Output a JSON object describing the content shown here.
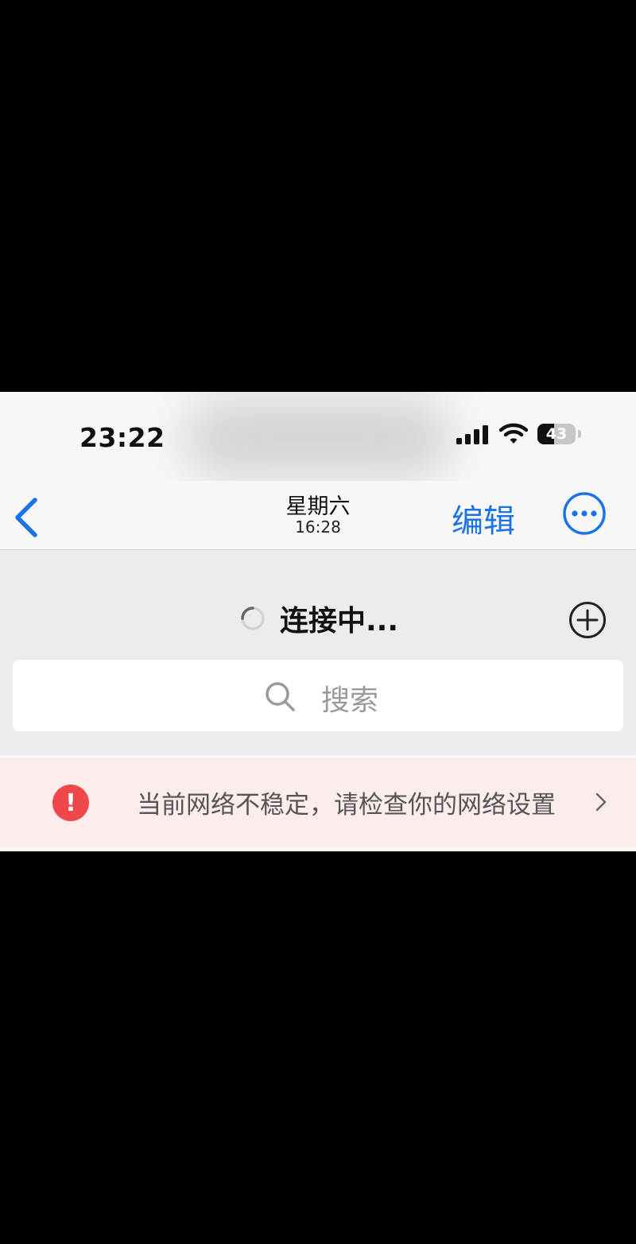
{
  "status_bar": {
    "time": "23:22",
    "battery_level": "43",
    "battery_fraction": 0.43,
    "icons": [
      "cellular-signal-icon",
      "wifi-icon",
      "battery-icon"
    ]
  },
  "nav": {
    "back_icon": "chevron-left-icon",
    "title": "星期六",
    "subtitle": "16:28",
    "edit_label": "编辑",
    "more_icon": "ellipsis-circle-icon"
  },
  "header": {
    "connecting_text": "连接中...",
    "spinner_icon": "loading-spinner-icon",
    "add_icon": "plus-circle-icon"
  },
  "search": {
    "placeholder": "搜索",
    "icon": "search-icon"
  },
  "warning": {
    "icon": "exclamation-circle-icon",
    "text": "当前网络不稳定，请检查你的网络设置",
    "chevron_icon": "chevron-right-icon"
  },
  "colors": {
    "accent": "#1a73e8",
    "warning_bg": "#fdecec",
    "warning_icon": "#f0474a",
    "page_bg": "#ececee"
  }
}
